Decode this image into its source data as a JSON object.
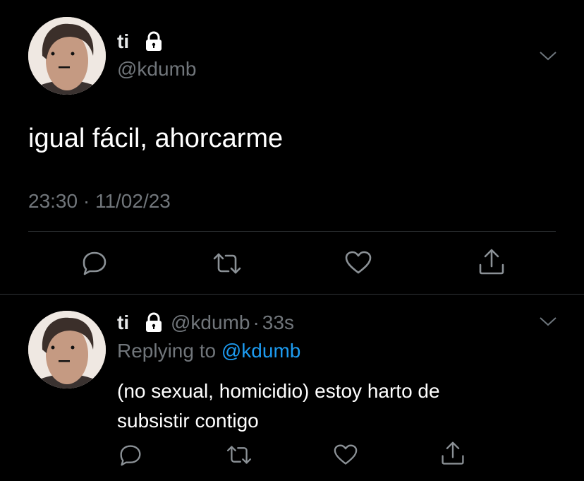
{
  "main_tweet": {
    "display_name": "ti",
    "handle": "@kdumb",
    "text": "igual fácil, ahorcarme",
    "timestamp": "23:30 · 11/02/23"
  },
  "reply_tweet": {
    "display_name": "ti",
    "handle": "@kdumb",
    "separator": "·",
    "time_ago": "33s",
    "replying_prefix": "Replying to",
    "replying_handle": "@kdumb",
    "text_line1": "(no sexual, homicidio) estoy harto de",
    "text_line2": "subsistir contigo"
  },
  "icons": {
    "lock": "lock-icon",
    "chevron": "chevron-down-icon",
    "reply": "reply-icon",
    "retweet": "retweet-icon",
    "like": "heart-icon",
    "share": "share-icon"
  },
  "colors": {
    "background": "#000000",
    "text": "#e7e9ea",
    "muted": "#71767b",
    "link": "#1d9bf0",
    "divider": "#2f3336"
  }
}
